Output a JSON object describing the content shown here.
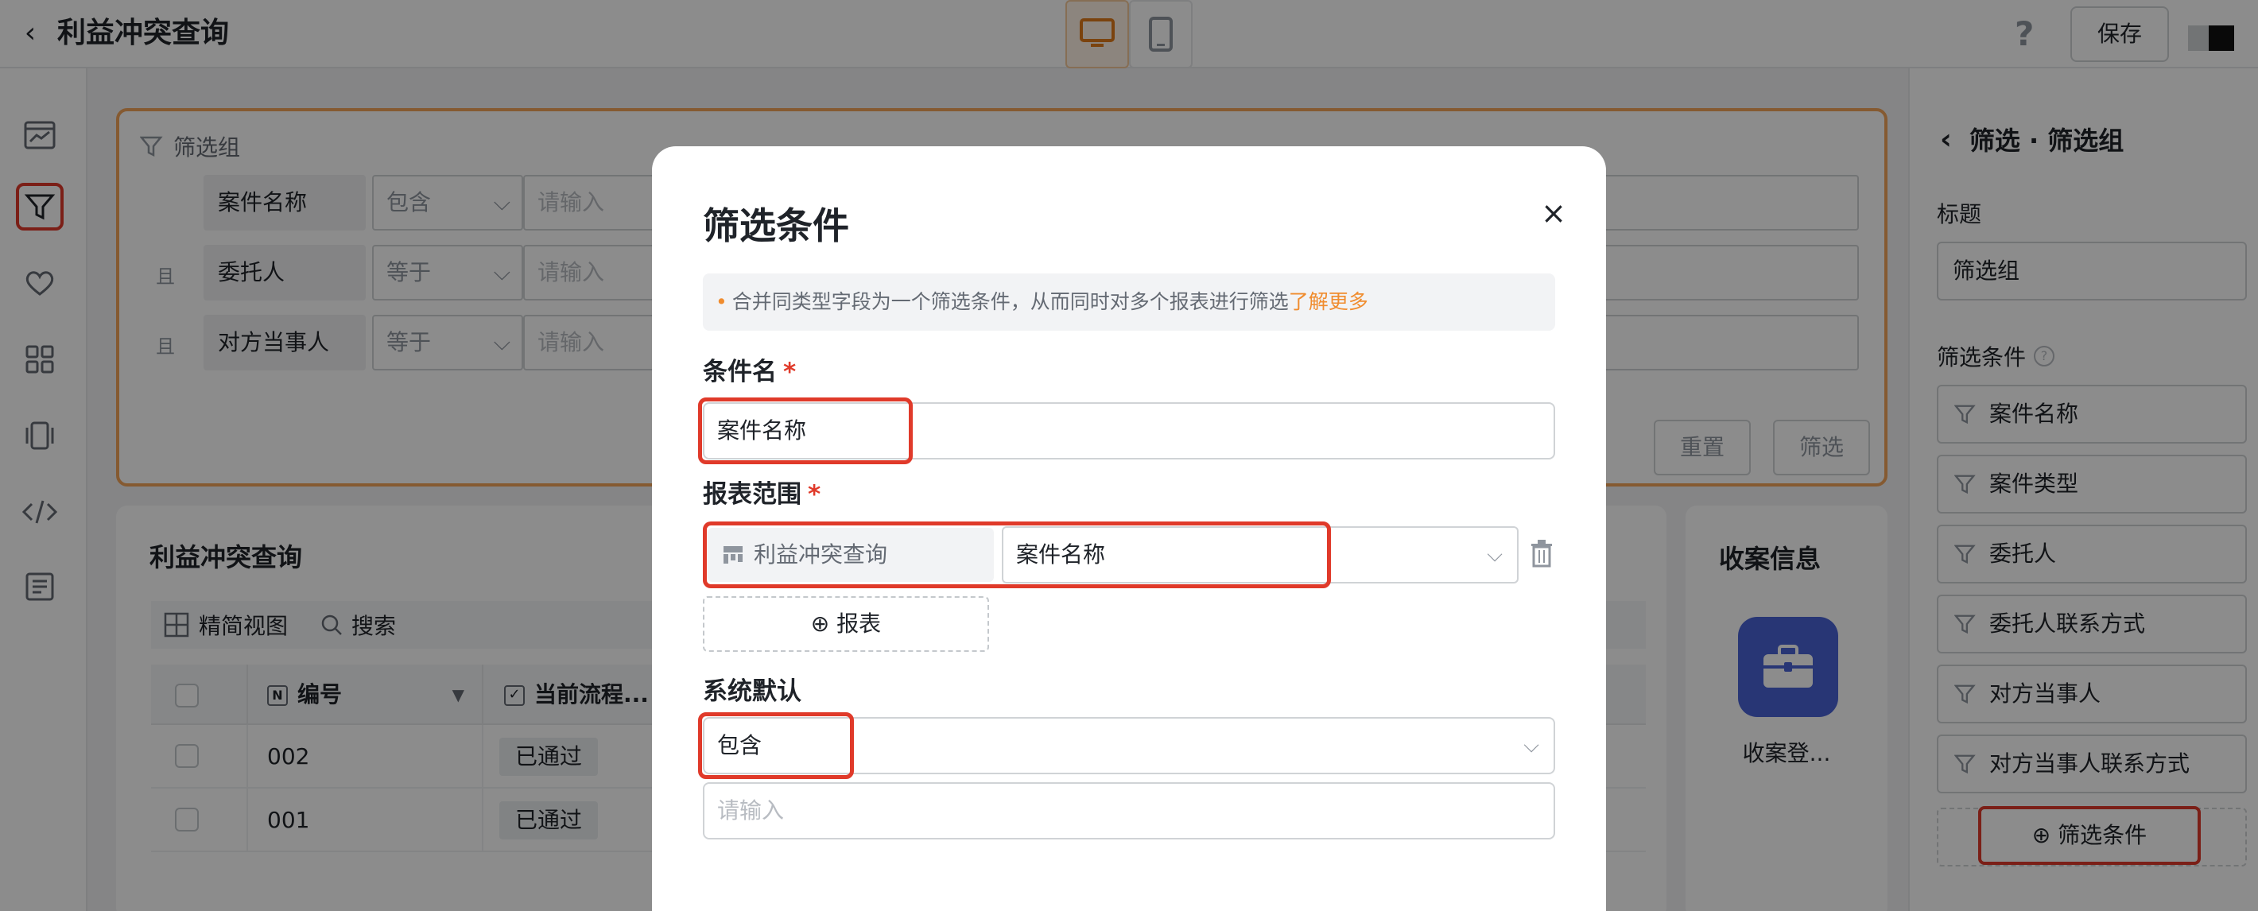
{
  "app": {
    "title": "利益冲突查询",
    "save_label": "保存",
    "help_glyph": "?"
  },
  "filter_group": {
    "title": "筛选组",
    "rows": [
      {
        "conj": "",
        "label": "案件名称",
        "op": "包含",
        "placeholder": "请输入"
      },
      {
        "conj": "且",
        "label": "委托人",
        "op": "等于",
        "placeholder": "请输入"
      },
      {
        "conj": "且",
        "label": "对方当事人",
        "op": "等于",
        "placeholder": "请输入"
      }
    ],
    "reset_label": "重置",
    "filter_label": "筛选"
  },
  "table": {
    "title": "利益冲突查询",
    "view_label": "精简视图",
    "search_label": "搜索",
    "col_id": "编号",
    "col_status": "当前流程...",
    "rows": [
      {
        "id": "002",
        "status": "已通过"
      },
      {
        "id": "001",
        "status": "已通过"
      }
    ]
  },
  "case_info": {
    "title": "收案信息",
    "item_label": "收案登..."
  },
  "right_panel": {
    "header": "筛选 · 筛选组",
    "title_label": "标题",
    "title_value": "筛选组",
    "conditions_label": "筛选条件",
    "conditions": [
      "案件名称",
      "案件类型",
      "委托人",
      "委托人联系方式",
      "对方当事人",
      "对方当事人联系方式"
    ],
    "add_condition_label": "筛选条件"
  },
  "modal": {
    "title": "筛选条件",
    "tip_text": "合并同类型字段为一个筛选条件，从而同时对多个报表进行筛选",
    "tip_link": "了解更多",
    "name_label": "条件名",
    "name_value": "案件名称",
    "scope_label": "报表范围",
    "scope_source": "利益冲突查询",
    "scope_field": "案件名称",
    "add_report_label": "报表",
    "default_label": "系统默认",
    "default_op": "包含",
    "default_placeholder": "请输入"
  },
  "colors": {
    "accent": "#f08c2e",
    "highlight": "#e03a2a",
    "app_icon": "#4a63d6"
  }
}
